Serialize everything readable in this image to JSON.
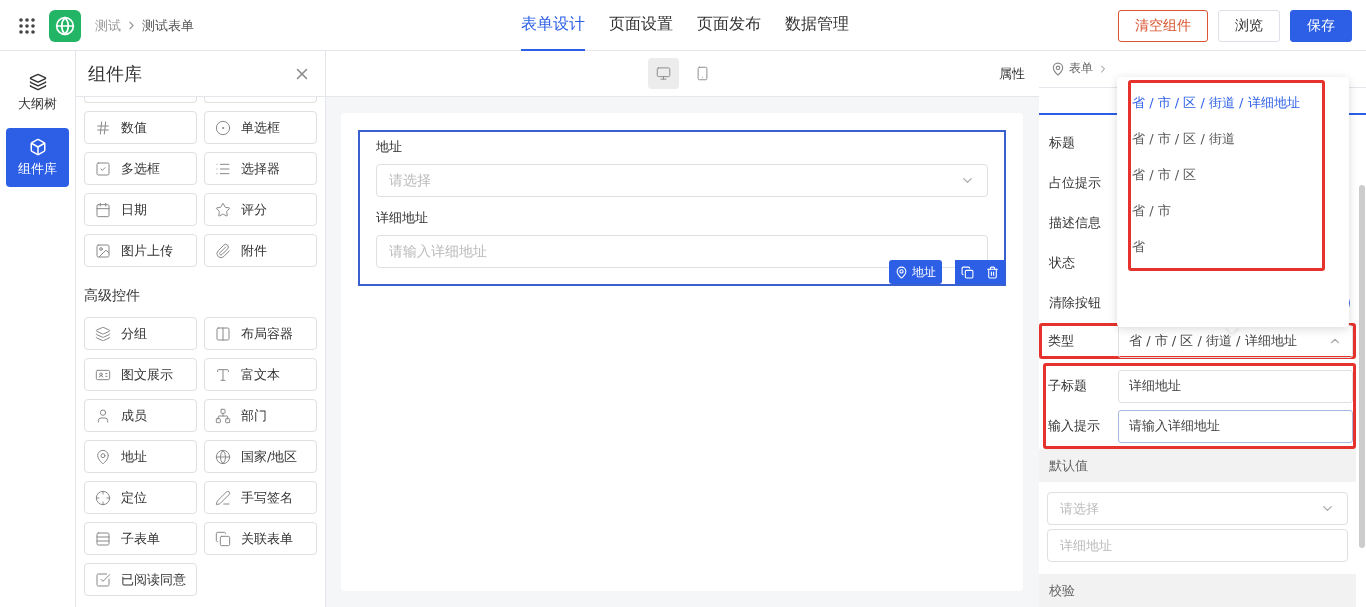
{
  "header": {
    "breadcrumb": [
      "测试",
      "测试表单"
    ],
    "tabs": [
      {
        "label": "表单设计",
        "selected": true
      },
      {
        "label": "页面设置",
        "selected": false
      },
      {
        "label": "页面发布",
        "selected": false
      },
      {
        "label": "数据管理",
        "selected": false
      }
    ],
    "buttons": [
      {
        "label": "清空组件",
        "kind": "danger"
      },
      {
        "label": "浏览",
        "kind": "default"
      },
      {
        "label": "保存",
        "kind": "primary"
      }
    ]
  },
  "rail": [
    {
      "label": "大纲树",
      "kind": "outline",
      "selected": false
    },
    {
      "label": "组件库",
      "kind": "library",
      "selected": true
    }
  ],
  "library": {
    "title": "组件库",
    "basic": [
      {
        "label": "数值",
        "kind": "number"
      },
      {
        "label": "单选框",
        "kind": "radio"
      },
      {
        "label": "多选框",
        "kind": "checkbox"
      },
      {
        "label": "选择器",
        "kind": "select"
      },
      {
        "label": "日期",
        "kind": "date"
      },
      {
        "label": "评分",
        "kind": "rating"
      },
      {
        "label": "图片上传",
        "kind": "image"
      },
      {
        "label": "附件",
        "kind": "attachment"
      }
    ],
    "advanced_title": "高级控件",
    "advanced": [
      {
        "label": "分组",
        "kind": "group"
      },
      {
        "label": "布局容器",
        "kind": "layout"
      },
      {
        "label": "图文展示",
        "kind": "imagetext"
      },
      {
        "label": "富文本",
        "kind": "richtext"
      },
      {
        "label": "成员",
        "kind": "member"
      },
      {
        "label": "部门",
        "kind": "department"
      },
      {
        "label": "地址",
        "kind": "address"
      },
      {
        "label": "国家/地区",
        "kind": "country"
      },
      {
        "label": "定位",
        "kind": "location"
      },
      {
        "label": "手写签名",
        "kind": "signature"
      },
      {
        "label": "子表单",
        "kind": "subform"
      },
      {
        "label": "关联表单",
        "kind": "linked"
      },
      {
        "label": "已阅读同意",
        "kind": "agree"
      }
    ]
  },
  "canvas": {
    "devices": [
      {
        "kind": "desktop",
        "selected": true
      },
      {
        "kind": "mobile",
        "selected": false
      }
    ],
    "properties_label": "属性",
    "field": {
      "label": "地址",
      "select_placeholder": "请选择",
      "sub_label": "详细地址",
      "input_placeholder": "请输入详细地址",
      "tag": "地址"
    }
  },
  "properties": {
    "breadcrumb": "表单",
    "rows": [
      {
        "label": "标题",
        "kind": "plain"
      },
      {
        "label": "占位提示",
        "kind": "plain"
      },
      {
        "label": "描述信息",
        "kind": "plain"
      },
      {
        "label": "状态",
        "kind": "plain"
      },
      {
        "label": "清除按钮",
        "kind": "switch",
        "on": true
      }
    ],
    "type": {
      "label": "类型",
      "value": "省 / 市 / 区 / 街道 / 详细地址",
      "expanded": true,
      "highlighted": true
    },
    "sub_fields": {
      "highlighted": true,
      "rows": [
        {
          "label": "子标题",
          "value": "详细地址",
          "focused": false
        },
        {
          "label": "输入提示",
          "value": "请输入详细地址",
          "focused": true
        }
      ]
    },
    "default_title": "默认值",
    "default_select_placeholder": "请选择",
    "default_input_placeholder": "详细地址",
    "validation_title": "校验",
    "dropdown": {
      "highlighted": true,
      "options": [
        {
          "label": "省 / 市 / 区 / 街道 / 详细地址",
          "selected": true
        },
        {
          "label": "省 / 市 / 区 / 街道",
          "selected": false
        },
        {
          "label": "省 / 市 / 区",
          "selected": false
        },
        {
          "label": "省 / 市",
          "selected": false
        },
        {
          "label": "省",
          "selected": false
        }
      ]
    }
  }
}
